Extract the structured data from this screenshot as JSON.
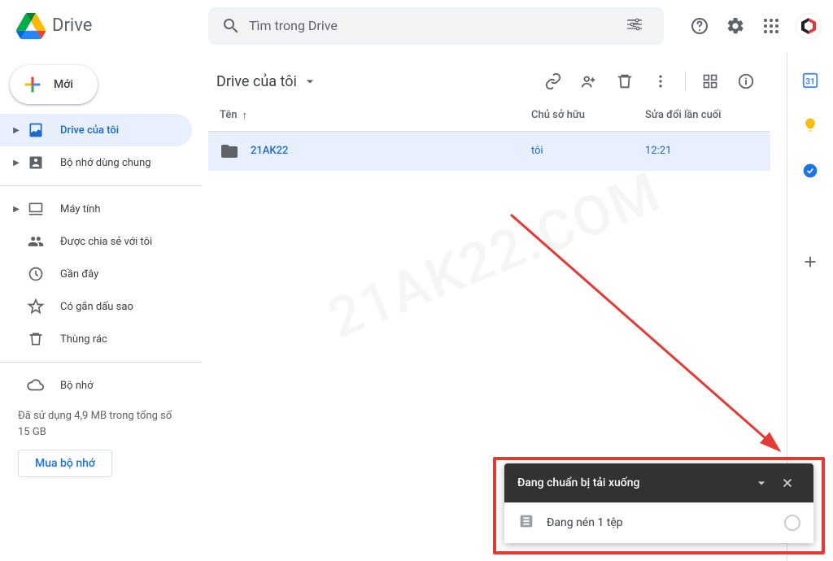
{
  "app": {
    "name": "Drive"
  },
  "search": {
    "placeholder": "Tìm trong Drive"
  },
  "sidebar": {
    "new_label": "Mới",
    "my_drive": "Drive của tôi",
    "shared_drives": "Bộ nhớ dùng chung",
    "computers": "Máy tính",
    "shared_with_me": "Được chia sẻ với tôi",
    "recent": "Gần đây",
    "starred": "Có gắn dấu sao",
    "trash": "Thùng rác",
    "storage": "Bộ nhớ",
    "storage_usage": "Đã sử dụng 4,9 MB trong tổng số 15 GB",
    "buy_label": "Mua bộ nhớ"
  },
  "breadcrumb": {
    "title": "Drive của tôi"
  },
  "columns": {
    "name": "Tên",
    "owner": "Chủ sở hữu",
    "modified": "Sửa đổi lần cuối"
  },
  "rows": [
    {
      "name": "21AK22",
      "owner": "tôi",
      "modified": "12:21"
    }
  ],
  "toast": {
    "title": "Đang chuẩn bị tải xuống",
    "status": "Đang nén 1 tệp"
  },
  "watermark": "21AK22.COM"
}
